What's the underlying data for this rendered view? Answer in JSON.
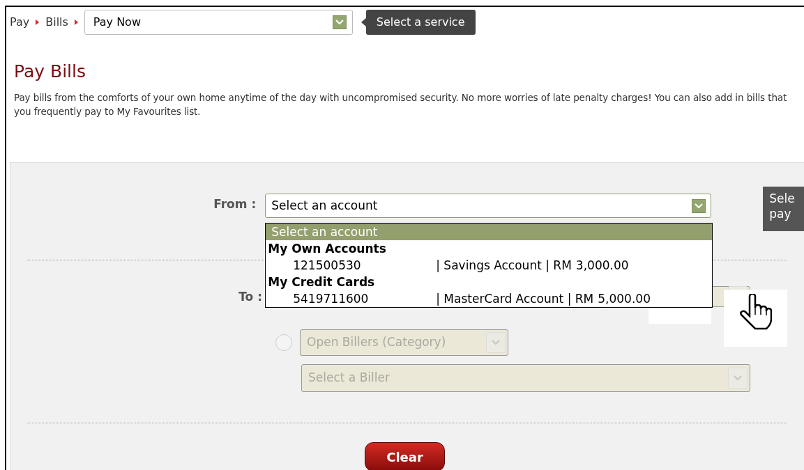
{
  "breadcrumb": {
    "items": [
      {
        "label": "Pay"
      },
      {
        "label": "Bills"
      }
    ],
    "service_select": {
      "value": "Pay Now"
    },
    "tooltip": "Select a service"
  },
  "title": "Pay Bills",
  "description": "Pay bills from the comforts of your own home anytime of the day with uncompromised security. No more worries of late penalty charges! You can also add in bills that you frequently pay to My Favourites list.",
  "form": {
    "from": {
      "label": "From :",
      "select": {
        "value": "Select an account",
        "expanded": true
      },
      "options": [
        {
          "kind": "placeholder",
          "label": "Select an account",
          "selected": true
        },
        {
          "kind": "group",
          "label": "My Own Accounts"
        },
        {
          "kind": "account",
          "number": "121500530",
          "type": "| Savings Account | RM",
          "amount": "3,000.00",
          "selected": false
        },
        {
          "kind": "group",
          "label": "My Credit Cards"
        },
        {
          "kind": "account",
          "number": "5419711600",
          "type": "| MasterCard Account | RM",
          "amount": "5,000.00",
          "selected": false
        }
      ],
      "tooltip_lines": [
        "Sele",
        "pay"
      ]
    },
    "to": {
      "label": "To :",
      "category": {
        "selected": false,
        "value": "Open Billers (Category)",
        "disabled": true
      },
      "biller": {
        "placeholder": "Select a Biller",
        "disabled": true
      }
    },
    "clear_button": "Clear"
  }
}
